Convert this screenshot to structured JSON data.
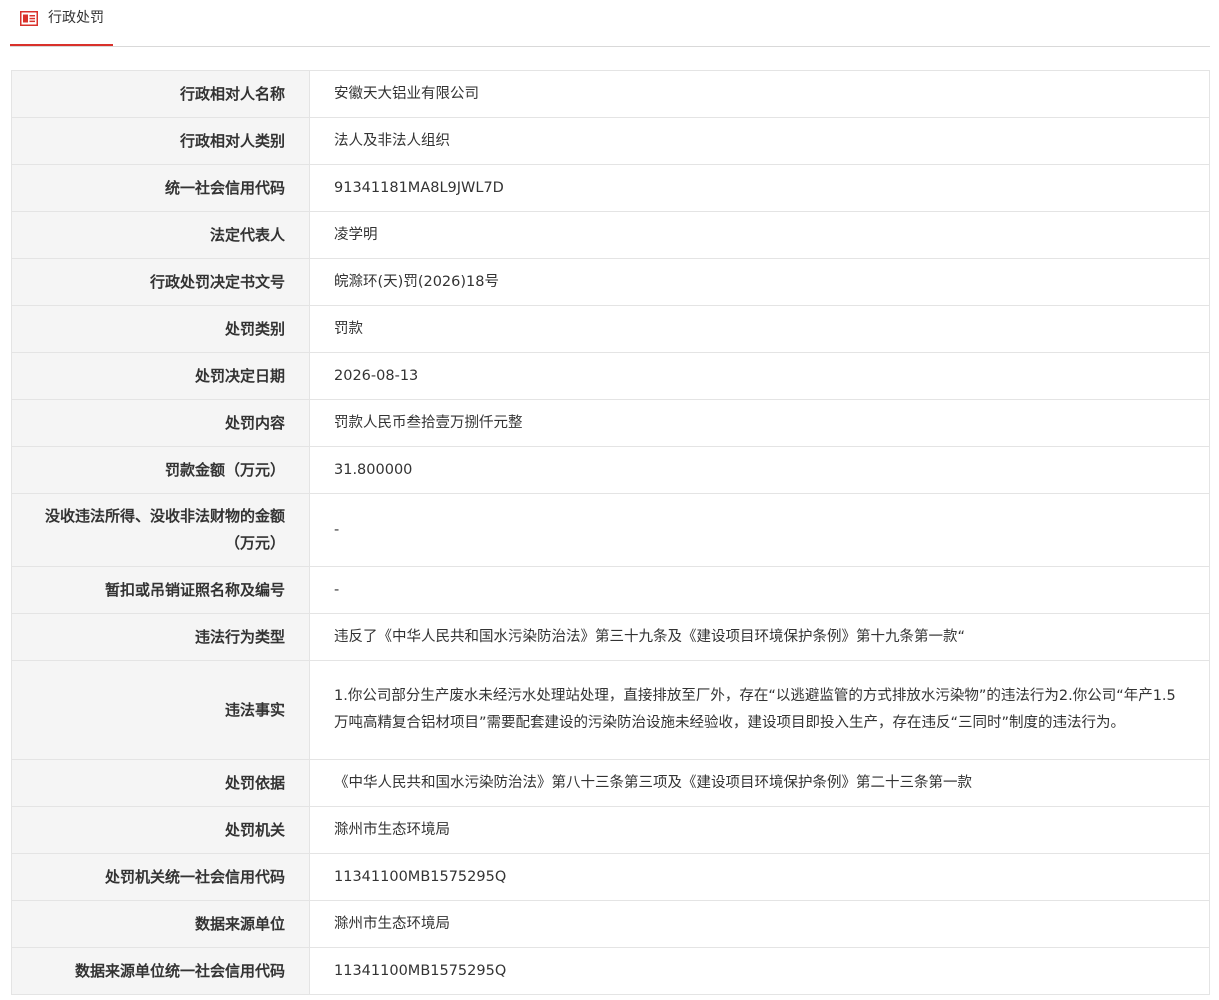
{
  "tab": {
    "label": "行政处罚",
    "icon": "document-icon",
    "accent": "#d9312b"
  },
  "rows": [
    {
      "label": "行政相对人名称",
      "value": "安徽天大铝业有限公司"
    },
    {
      "label": "行政相对人类别",
      "value": "法人及非法人组织"
    },
    {
      "label": "统一社会信用代码",
      "value": "91341181MA8L9JWL7D"
    },
    {
      "label": "法定代表人",
      "value": "凌学明"
    },
    {
      "label": "行政处罚决定书文号",
      "value": "皖滁环(天)罚(2026)18号"
    },
    {
      "label": "处罚类别",
      "value": "罚款"
    },
    {
      "label": "处罚决定日期",
      "value": "2026-08-13"
    },
    {
      "label": "处罚内容",
      "value": "罚款人民币叁拾壹万捌仟元整"
    },
    {
      "label": "罚款金额（万元）",
      "value": "31.800000"
    },
    {
      "label": "没收违法所得、没收非法财物的金额（万元）",
      "value": "-"
    },
    {
      "label": "暂扣或吊销证照名称及编号",
      "value": "-"
    },
    {
      "label": "违法行为类型",
      "value": "违反了《中华人民共和国水污染防治法》第三十九条及《建设项目环境保护条例》第十九条第一款“"
    },
    {
      "label": "违法事实",
      "value": "1.你公司部分生产废水未经污水处理站处理，直接排放至厂外，存在“以逃避监管的方式排放水污染物”的违法行为2.你公司“年产1.5万吨高精复合铝材项目”需要配套建设的污染防治设施未经验收，建设项目即投入生产，存在违反“三同时”制度的违法行为。"
    },
    {
      "label": "处罚依据",
      "value": "《中华人民共和国水污染防治法》第八十三条第三项及《建设项目环境保护条例》第二十三条第一款"
    },
    {
      "label": "处罚机关",
      "value": "滁州市生态环境局"
    },
    {
      "label": "处罚机关统一社会信用代码",
      "value": "11341100MB1575295Q"
    },
    {
      "label": "数据来源单位",
      "value": "滁州市生态环境局"
    },
    {
      "label": "数据来源单位统一社会信用代码",
      "value": "11341100MB1575295Q"
    }
  ]
}
